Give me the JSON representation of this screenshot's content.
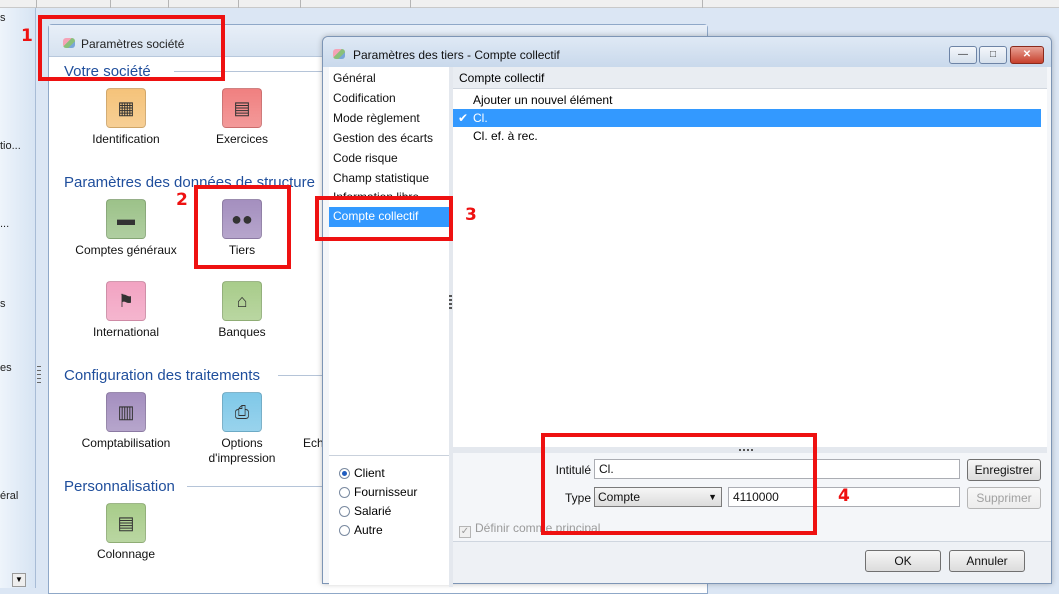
{
  "left_panel": {
    "labels": [
      "s",
      "tio...",
      "...",
      "s",
      "es",
      "éral"
    ],
    "scroll_down": "▼"
  },
  "back_window": {
    "title": "Paramètres société",
    "sections": [
      "Votre société",
      "Paramètres des données de structure",
      "Configuration des traitements",
      "Personnalisation"
    ],
    "tiles": [
      {
        "label": "Identification",
        "icon": "building-icon",
        "color": "#f5c37a"
      },
      {
        "label": "Exercices",
        "icon": "calendar-icon",
        "color": "#f08080"
      },
      {
        "label": "Comptes généraux",
        "icon": "folder-icon",
        "color": "#9cc289"
      },
      {
        "label": "Tiers",
        "icon": "people-icon",
        "color": "#a48fbf"
      },
      {
        "label": "International",
        "icon": "flags-icon",
        "color": "#f2a3c2"
      },
      {
        "label": "Banques",
        "icon": "bank-icon",
        "color": "#a8cc8a"
      },
      {
        "label": "Comptabilisation",
        "icon": "ledger-icon",
        "color": "#a48fbf"
      },
      {
        "label": "Options\nd'impression",
        "icon": "printer-icon",
        "color": "#7fc8e8"
      },
      {
        "label": "Colonnage",
        "icon": "document-icon",
        "color": "#a8cc8a"
      }
    ],
    "partial_label": "Ech"
  },
  "dialog": {
    "title": "Paramètres des tiers - Compte collectif",
    "window_buttons": {
      "minimize": "—",
      "maximize": "□",
      "close": "✕"
    },
    "nav": [
      "Général",
      "Codification",
      "Mode règlement",
      "Gestion des écarts",
      "Code risque",
      "Champ statistique",
      "Information libre",
      "Compte collectif"
    ],
    "nav_selected": "Compte collectif",
    "radios": [
      {
        "label": "Client",
        "checked": true
      },
      {
        "label": "Fournisseur",
        "checked": false
      },
      {
        "label": "Salarié",
        "checked": false
      },
      {
        "label": "Autre",
        "checked": false
      }
    ],
    "list_header": "Compte collectif",
    "list_items": [
      {
        "label": "Ajouter un nouvel élément",
        "selected": false
      },
      {
        "label": "Cl.",
        "selected": true
      },
      {
        "label": "Cl. ef. à rec.",
        "selected": false
      }
    ],
    "check_mark": "✔",
    "form": {
      "intitule_label": "Intitulé",
      "intitule_value": "Cl.",
      "type_label": "Type",
      "type_value": "Compte",
      "account_value": "4110000",
      "save_button": "Enregistrer",
      "delete_button": "Supprimer",
      "principal_label": "Définir comme principal",
      "principal_checked": true
    },
    "ok_button": "OK",
    "cancel_button": "Annuler"
  },
  "annotations": {
    "numbers": [
      "1",
      "2",
      "3",
      "4"
    ],
    "color": "#ee1111"
  }
}
